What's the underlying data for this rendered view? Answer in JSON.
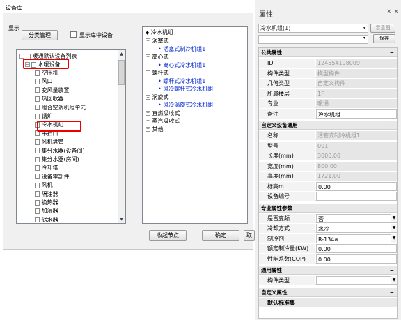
{
  "dialog": {
    "title": "设备库",
    "group_label": "显示",
    "classify_button": "分类管理",
    "show_in_lib_label": "显示库中设备",
    "collapse_button": "收起节点",
    "ok_button": "确定",
    "cut_button": "取"
  },
  "tree1": {
    "root": "暖通默认设备列表",
    "category": "水暖设备",
    "items": [
      "空压机",
      "风口",
      "变风量装置",
      "热回收器",
      "组合空调机组单元",
      "锅炉",
      "冷水机组",
      "吊扫口",
      "风机盘管",
      "集分水器(设备间)",
      "集分水器(房间)",
      "冷却塔",
      "设备零部件",
      "风机",
      "隔油器",
      "换热器",
      "加湿器",
      "储水器"
    ]
  },
  "tree2": {
    "root": "冷水机组",
    "groups": [
      {
        "label": "涡塞式",
        "children": [
          "活塞式制冷机组1"
        ]
      },
      {
        "label": "离心式",
        "children": [
          "离心式冷水机组1"
        ]
      },
      {
        "label": "螺杆式",
        "children": [
          "螺杆式冷水机组1",
          "风冷螺杆式冷水机组"
        ]
      },
      {
        "label": "涡旋式",
        "children": [
          "风冷涡旋式冷水机组"
        ]
      },
      {
        "label": "直燃吸收式",
        "children": []
      },
      {
        "label": "蒸汽吸收式",
        "children": []
      },
      {
        "label": "其他",
        "children": []
      }
    ]
  },
  "panel": {
    "title": "属性",
    "close": "× ×",
    "combo_value": "冷水机组(1)",
    "show_button": "示意图",
    "save_button": "保存",
    "sections": [
      {
        "title": "公共属性",
        "rows": [
          {
            "k": "ID",
            "v": "124554198009",
            "ro": true
          },
          {
            "k": "构件类型",
            "v": "模型构件",
            "ro": true
          },
          {
            "k": "几何类型",
            "v": "自定义构件",
            "ro": true
          },
          {
            "k": "所属楼层",
            "v": "1F",
            "ro": true
          },
          {
            "k": "专业",
            "v": "暖通",
            "ro": true
          },
          {
            "k": "备注",
            "v": "冷水机组",
            "ro": false
          }
        ]
      },
      {
        "title": "自定义设备通用",
        "rows": [
          {
            "k": "名称",
            "v": "活塞式制冷机组1",
            "ro": true
          },
          {
            "k": "型号",
            "v": "001",
            "ro": true
          },
          {
            "k": "长度(mm)",
            "v": "3000.00",
            "ro": true
          },
          {
            "k": "宽度(mm)",
            "v": "800.00",
            "ro": true
          },
          {
            "k": "高度(mm)",
            "v": "1721.00",
            "ro": true
          },
          {
            "k": "标高m",
            "v": "0.00",
            "ro": false
          },
          {
            "k": "设备编号",
            "v": "",
            "ro": false
          }
        ]
      },
      {
        "title": "专业属性参数",
        "rows": [
          {
            "k": "是否变频",
            "v": "否",
            "ro": false,
            "dd": true
          },
          {
            "k": "冷却方式",
            "v": "水冷",
            "ro": false,
            "dd": true
          },
          {
            "k": "制冷剂",
            "v": "R-134a",
            "ro": false,
            "dd": true
          },
          {
            "k": "额定制冷量(KW)",
            "v": "0.00",
            "ro": false
          },
          {
            "k": "性能系数(COP)",
            "v": "0.00",
            "ro": false
          }
        ]
      },
      {
        "title": "通用属性",
        "rows": [
          {
            "k": "构件类型",
            "v": "",
            "ro": false,
            "dd": true
          }
        ]
      },
      {
        "title": "自定义属性",
        "rows": [
          {
            "k": "默认标准集",
            "v": "",
            "ro": false,
            "bold": true
          }
        ]
      }
    ]
  }
}
